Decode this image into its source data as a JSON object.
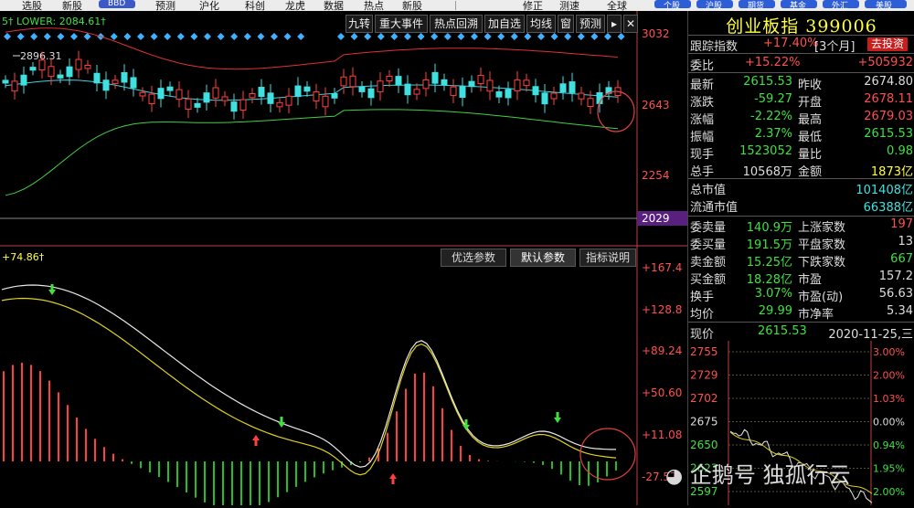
{
  "topbar": {
    "items": [
      "选股",
      "新股",
      "BBD",
      "预测",
      "沪化",
      "科创",
      "龙虎",
      "数据",
      "热点",
      "新股",
      "修正",
      "测速",
      "全球",
      "个股",
      "沪股",
      "期货",
      "基金",
      "外汇",
      "美股"
    ]
  },
  "main_chart": {
    "indicator_label": "5† LOWER: 2084.61†",
    "high_marker": "2896.31",
    "axis_labels": [
      "3032",
      "2643",
      "2254"
    ],
    "axis_highlight": "2029",
    "tools": [
      "九转",
      "重大事件",
      "热点回溯",
      "加自选",
      "均线",
      "窗",
      "预测"
    ]
  },
  "sub_chart": {
    "indicator_label": "+74.86†",
    "axis_labels": [
      "+167.4",
      "+128.8",
      "+89.24",
      "+50.60",
      "+11.08",
      "-27.57"
    ],
    "params": [
      "优选参数",
      "默认参数",
      "指标说明"
    ],
    "colors": {
      "fast": "#e8e8e8",
      "slow": "#e0d020",
      "pos": "#ff4040",
      "neg": "#20c020"
    }
  },
  "panel": {
    "title": "创业板指 399006",
    "tracking": {
      "label": "跟踪指数",
      "value": "+17.40%",
      "period": "[3个月]",
      "button": "去投资"
    },
    "weibi": {
      "label": "委比",
      "value": "+15.22%",
      "extra": "+505932"
    },
    "quotes": [
      {
        "l1": "最新",
        "v1": "2615.53",
        "c1": "green",
        "l2": "昨收",
        "v2": "2674.80",
        "c2": "white"
      },
      {
        "l1": "涨跌",
        "v1": "-59.27",
        "c1": "green",
        "l2": "开盘",
        "v2": "2678.11",
        "c2": "red"
      },
      {
        "l1": "涨幅",
        "v1": "-2.22%",
        "c1": "green",
        "l2": "最高",
        "v2": "2679.03",
        "c2": "red"
      },
      {
        "l1": "振幅",
        "v1": "2.37%",
        "c1": "green",
        "l2": "最低",
        "v2": "2615.53",
        "c2": "green"
      },
      {
        "l1": "现手",
        "v1": "1523052",
        "c1": "green",
        "l2": "量比",
        "v2": "0.98",
        "c2": "green"
      },
      {
        "l1": "总手",
        "v1": "10568万",
        "c1": "white",
        "l2": "金额",
        "v2": "1873亿",
        "c2": "yellow"
      }
    ],
    "market_cap": [
      {
        "label": "总市值",
        "value": "101408亿"
      },
      {
        "label": "流通市值",
        "value": "66388亿"
      }
    ],
    "stats": [
      {
        "l1": "委卖量",
        "v1": "140.9万",
        "l2": "上涨家数",
        "v2": "197",
        "c2": "red"
      },
      {
        "l1": "委买量",
        "v1": "191.5万",
        "l2": "平盘家数",
        "v2": "13",
        "c2": "white"
      },
      {
        "l1": "卖金额",
        "v1": "15.25亿",
        "l2": "下跌家数",
        "v2": "667",
        "c2": "green"
      },
      {
        "l1": "买金额",
        "v1": "18.28亿",
        "l2": "市盈",
        "v2": "157.2",
        "c2": "white"
      },
      {
        "l1": "换手",
        "v1": "3.07%",
        "l2": "市盈(动)",
        "v2": "56.63",
        "c2": "white"
      },
      {
        "l1": "均价",
        "v1": "29.99",
        "l2": "市净率",
        "v2": "5.34",
        "c2": "white"
      }
    ],
    "price_row": {
      "label": "现价",
      "value": "2615.53",
      "date": "2020-11-25,三"
    },
    "mini_left": [
      "2755",
      "2729",
      "2702",
      "2675",
      "2650",
      "2623",
      "2597"
    ],
    "mini_right": [
      "3.00%",
      "2.00%",
      "1.03%",
      "0.00%",
      "0.94%",
      "1.95%",
      "2.00%"
    ]
  },
  "watermark": "企鹅号 独孤行云"
}
